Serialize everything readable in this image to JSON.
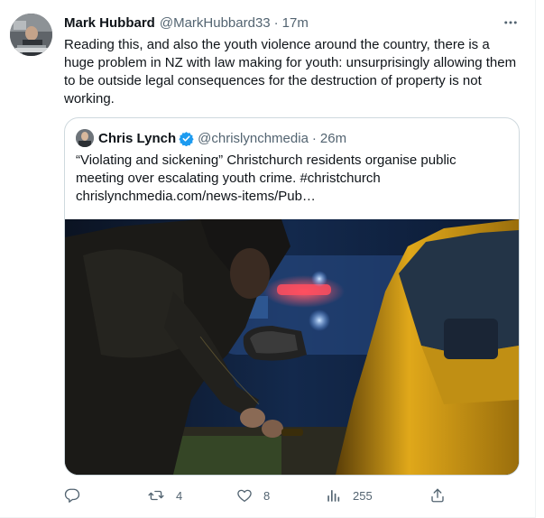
{
  "tweet": {
    "author_name": "Mark Hubbard",
    "handle": "@MarkHubbard33",
    "separator": "·",
    "time": "17m",
    "text": "Reading this, and also the youth violence around the country, there is a huge problem in NZ with law making for youth: unsurprisingly allowing them to be outside legal consequences for the destruction of property is not working."
  },
  "quote": {
    "author_name": "Chris Lynch",
    "handle": "@chrislynchmedia",
    "separator": "·",
    "time": "26m",
    "text_main": "“Violating and sickening” Christchurch residents organise public meeting over escalating youth crime.",
    "hashtag": "#christchurch",
    "link": "chrislynchmedia.com/news-items/Pub…"
  },
  "actions": {
    "reply_count": "",
    "retweet_count": "4",
    "like_count": "8",
    "views_count": "255"
  },
  "icons": {
    "more": "more-horizontal-icon",
    "verified": "verified-badge-icon",
    "reply": "reply-icon",
    "retweet": "retweet-icon",
    "like": "heart-icon",
    "views": "views-icon",
    "share": "share-icon"
  },
  "colors": {
    "text": "#0f1419",
    "secondary": "#536471",
    "verified": "#1d9bf0",
    "border": "#cfd9de",
    "car": "#e0a81a"
  }
}
